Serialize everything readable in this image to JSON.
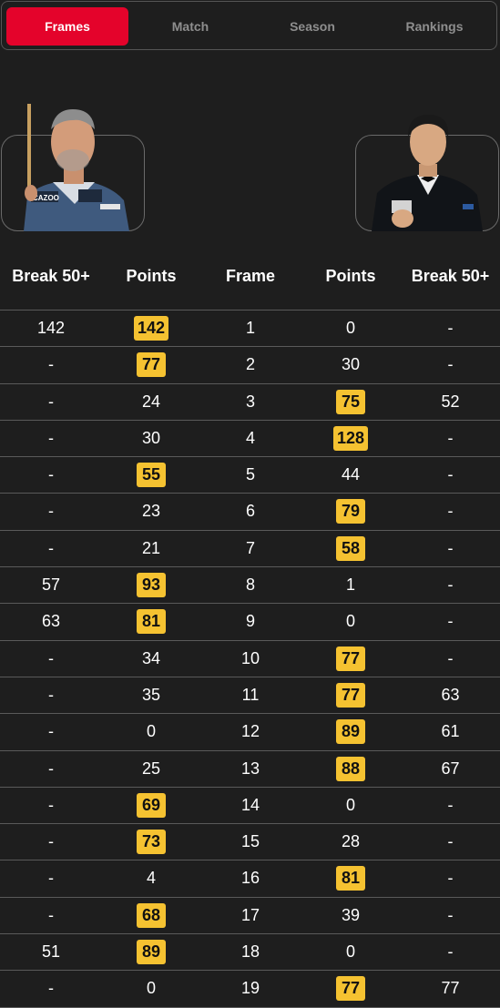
{
  "tabs": [
    {
      "label": "Frames",
      "active": true
    },
    {
      "label": "Match",
      "active": false
    },
    {
      "label": "Season",
      "active": false
    },
    {
      "label": "Rankings",
      "active": false
    }
  ],
  "colors": {
    "accent": "#e4032b",
    "winner_highlight": "#f5c231",
    "background": "#1e1e1e",
    "divider": "#5a5a5a"
  },
  "table": {
    "headers": [
      "Break 50+",
      "Points",
      "Frame",
      "Points",
      "Break 50+"
    ],
    "rows": [
      {
        "left_break": "142",
        "left_points": "142",
        "frame": "1",
        "right_points": "0",
        "right_break": "-",
        "winner": "left"
      },
      {
        "left_break": "-",
        "left_points": "77",
        "frame": "2",
        "right_points": "30",
        "right_break": "-",
        "winner": "left"
      },
      {
        "left_break": "-",
        "left_points": "24",
        "frame": "3",
        "right_points": "75",
        "right_break": "52",
        "winner": "right"
      },
      {
        "left_break": "-",
        "left_points": "30",
        "frame": "4",
        "right_points": "128",
        "right_break": "-",
        "winner": "right"
      },
      {
        "left_break": "-",
        "left_points": "55",
        "frame": "5",
        "right_points": "44",
        "right_break": "-",
        "winner": "left"
      },
      {
        "left_break": "-",
        "left_points": "23",
        "frame": "6",
        "right_points": "79",
        "right_break": "-",
        "winner": "right"
      },
      {
        "left_break": "-",
        "left_points": "21",
        "frame": "7",
        "right_points": "58",
        "right_break": "-",
        "winner": "right"
      },
      {
        "left_break": "57",
        "left_points": "93",
        "frame": "8",
        "right_points": "1",
        "right_break": "-",
        "winner": "left"
      },
      {
        "left_break": "63",
        "left_points": "81",
        "frame": "9",
        "right_points": "0",
        "right_break": "-",
        "winner": "left"
      },
      {
        "left_break": "-",
        "left_points": "34",
        "frame": "10",
        "right_points": "77",
        "right_break": "-",
        "winner": "right"
      },
      {
        "left_break": "-",
        "left_points": "35",
        "frame": "11",
        "right_points": "77",
        "right_break": "63",
        "winner": "right"
      },
      {
        "left_break": "-",
        "left_points": "0",
        "frame": "12",
        "right_points": "89",
        "right_break": "61",
        "winner": "right"
      },
      {
        "left_break": "-",
        "left_points": "25",
        "frame": "13",
        "right_points": "88",
        "right_break": "67",
        "winner": "right"
      },
      {
        "left_break": "-",
        "left_points": "69",
        "frame": "14",
        "right_points": "0",
        "right_break": "-",
        "winner": "left"
      },
      {
        "left_break": "-",
        "left_points": "73",
        "frame": "15",
        "right_points": "28",
        "right_break": "-",
        "winner": "left"
      },
      {
        "left_break": "-",
        "left_points": "4",
        "frame": "16",
        "right_points": "81",
        "right_break": "-",
        "winner": "right"
      },
      {
        "left_break": "-",
        "left_points": "68",
        "frame": "17",
        "right_points": "39",
        "right_break": "-",
        "winner": "left"
      },
      {
        "left_break": "51",
        "left_points": "89",
        "frame": "18",
        "right_points": "0",
        "right_break": "-",
        "winner": "left"
      },
      {
        "left_break": "-",
        "left_points": "0",
        "frame": "19",
        "right_points": "77",
        "right_break": "77",
        "winner": "right"
      }
    ]
  }
}
